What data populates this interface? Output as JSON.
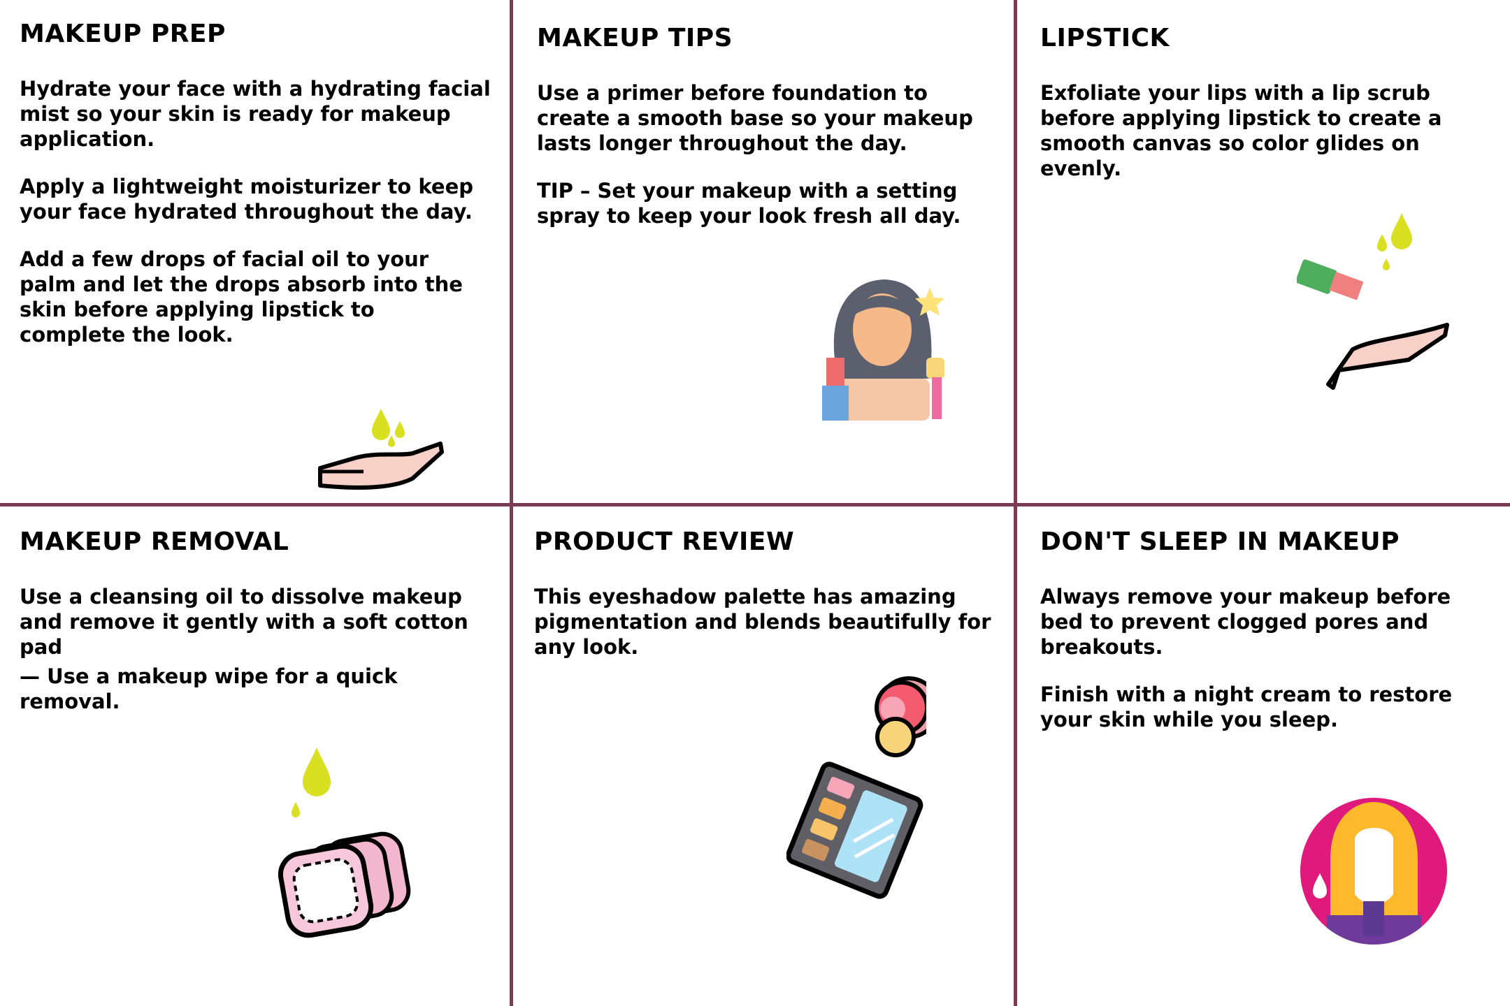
{
  "panels": [
    {
      "title": "MAKEUP PREP",
      "paragraphs": [
        "Hydrate your face with a hydrating facial mist so your skin is ready for makeup application.",
        "Apply a lightweight moisturizer to keep your face hydrated throughout the day.",
        "Add a few drops of facial oil to your palm and let the drops absorb into the skin before applying lipstick to complete the look."
      ],
      "illustration": "hand-with-oil-drops-icon"
    },
    {
      "title": "MAKEUP TIPS",
      "paragraphs": [
        "Use a primer before foundation to create a smooth base so your makeup lasts longer throughout the day.",
        "TIP – Set your makeup with a setting spray to keep your look fresh all day."
      ],
      "illustration": "woman-with-makeup-icon"
    },
    {
      "title": "LIPSTICK",
      "paragraphs": [
        "Exfoliate your lips with a lip scrub before applying lipstick to create a smooth canvas so color glides on evenly."
      ],
      "illustration": "hand-with-lipstick-and-drops-icon"
    },
    {
      "title": "MAKEUP REMOVAL",
      "paragraphs": [
        "Use a cleansing oil to dissolve makeup and remove it gently with a soft cotton pad",
        "— Use a makeup wipe for a quick removal."
      ],
      "illustration": "cotton-pads-with-oil-icon"
    },
    {
      "title": "PRODUCT REVIEW",
      "paragraphs": [
        "This eyeshadow palette has amazing pigmentation and blends beautifully for any look."
      ],
      "illustration": "compact-and-eyeshadow-palette-icon"
    },
    {
      "title": "DON'T SLEEP IN MAKEUP",
      "paragraphs": [
        "Always remove your makeup before bed to prevent clogged pores and breakouts.",
        "Finish with a night cream to restore your skin while you sleep."
      ],
      "illustration": "woman-with-tear-drop-icon"
    }
  ]
}
